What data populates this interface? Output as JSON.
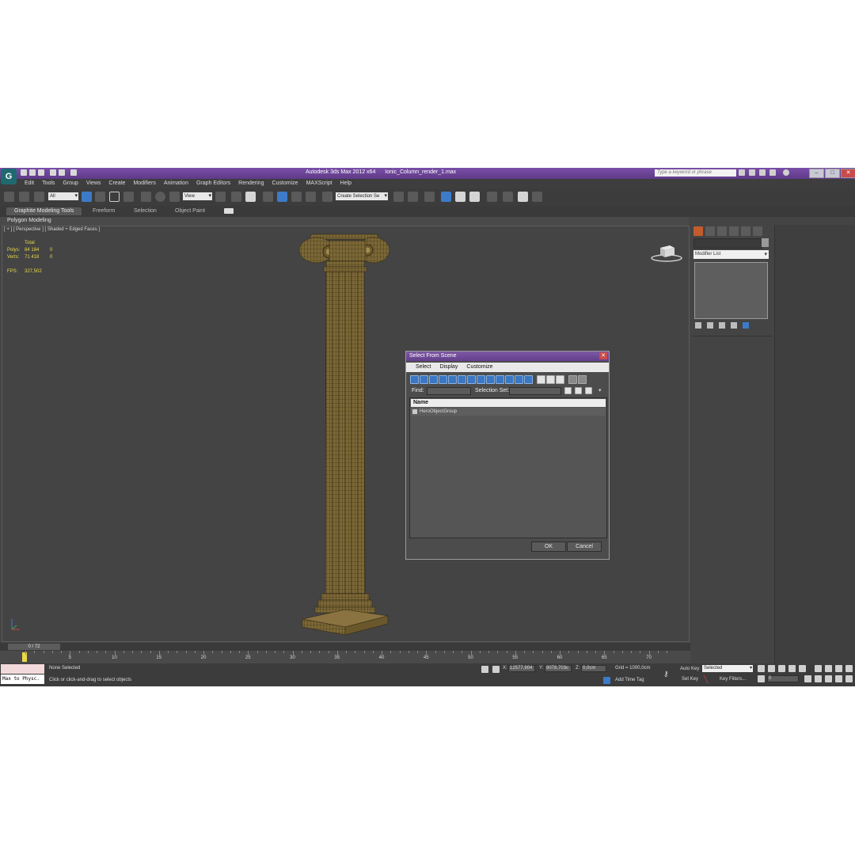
{
  "window": {
    "product": "Autodesk 3ds Max  2012 x64",
    "file": "Ionic_Column_render_1.max",
    "search_placeholder": "Type a keyword or phrase",
    "logo_glyph": "G"
  },
  "menu": [
    "Edit",
    "Tools",
    "Group",
    "Views",
    "Create",
    "Modifiers",
    "Animation",
    "Graph Editors",
    "Rendering",
    "Customize",
    "MAXScript",
    "Help"
  ],
  "toolbar": {
    "filter_value": "All",
    "refcoord_value": "View",
    "named_selection_value": "Create Selection Se"
  },
  "ribbon": {
    "tabs": [
      "Graphite Modeling Tools",
      "Freeform",
      "Selection",
      "Object Paint"
    ],
    "active_tab": "Graphite Modeling Tools",
    "sub_label": "Polygon Modeling"
  },
  "viewport": {
    "label": "[ + ] [ Perspective ] [ Shaded + Edged Faces ]",
    "stats": {
      "total_header": "Total",
      "polys_label": "Polys:",
      "polys_total": "84 184",
      "polys_sel": "0",
      "verts_label": "Verts:",
      "verts_total": "71 418",
      "verts_sel": "0",
      "fps_label": "FPS:",
      "fps_value": "327,502"
    }
  },
  "dialog": {
    "title": "Select From Scene",
    "close_glyph": "✕",
    "menu": [
      "Select",
      "Display",
      "Customize"
    ],
    "find_label": "Find:",
    "selection_set_label": "Selection Set:",
    "column_header": "Name",
    "items": [
      "HeroObjectGroup"
    ],
    "ok_label": "OK",
    "cancel_label": "Cancel"
  },
  "command_panel": {
    "modifier_list": "Modifier List"
  },
  "timeline": {
    "frame_readout": "0 / 72",
    "ticks": [
      "5",
      "10",
      "15",
      "20",
      "25",
      "30",
      "35",
      "40",
      "45",
      "50",
      "55",
      "60",
      "65",
      "70"
    ]
  },
  "status": {
    "maxscript_text": "Max to Physc.",
    "selection_status": "None Selected",
    "prompt": "Click or click-and-drag to select objects",
    "x_label": "X:",
    "x_value": "12577,904",
    "y_label": "Y:",
    "y_value": "9078,703c",
    "z_label": "Z:",
    "z_value": "0,0cm",
    "grid": "Grid = 1000,0cm",
    "add_time_tag": "Add Time Tag",
    "auto_key": "Auto Key",
    "set_key": "Set Key",
    "selected_combo": "Selected",
    "key_filters": "Key Filters...",
    "frame_field": "0"
  },
  "colors": {
    "title_purple": "#6b459a",
    "viewport_bg": "#444444",
    "stats_yellow": "#e8d84a",
    "column_gold": "#8a7340"
  }
}
